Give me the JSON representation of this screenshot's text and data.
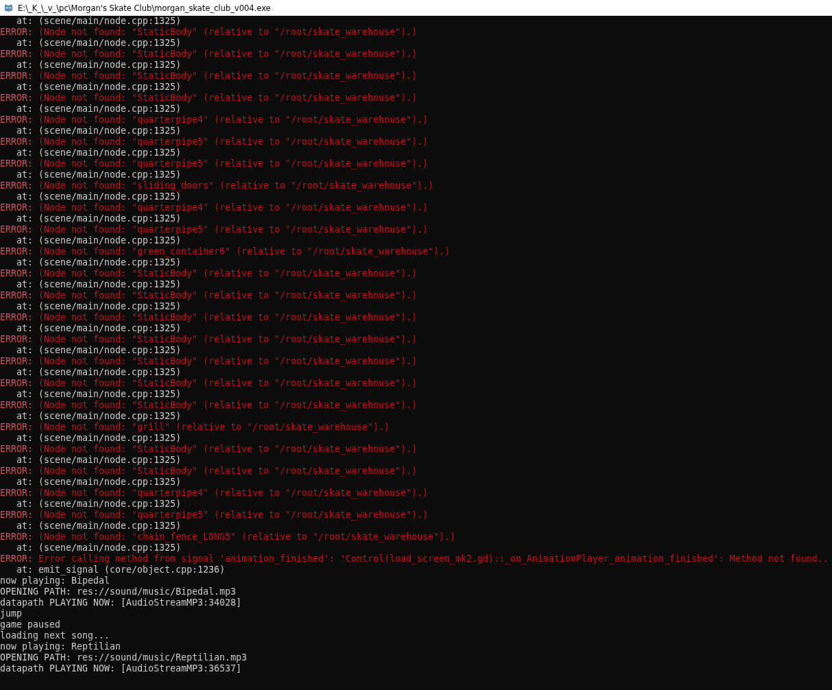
{
  "window": {
    "title": "E:\\_K_\\_v_\\pc\\Morgan's Skate Club\\morgan_skate_club_v004.exe"
  },
  "lines": [
    {
      "kind": "trace",
      "text": "at: (scene/main/node.cpp:1325)"
    },
    {
      "kind": "error",
      "label": "ERROR:",
      "text": "(Node not found: \"StaticBody\" (relative to \"/root/skate_warehouse\").)"
    },
    {
      "kind": "trace",
      "text": "at: (scene/main/node.cpp:1325)"
    },
    {
      "kind": "error",
      "label": "ERROR:",
      "text": "(Node not found: \"StaticBody\" (relative to \"/root/skate_warehouse\").)"
    },
    {
      "kind": "trace",
      "text": "at: (scene/main/node.cpp:1325)"
    },
    {
      "kind": "error",
      "label": "ERROR:",
      "text": "(Node not found: \"StaticBody\" (relative to \"/root/skate_warehouse\").)"
    },
    {
      "kind": "trace",
      "text": "at: (scene/main/node.cpp:1325)"
    },
    {
      "kind": "error",
      "label": "ERROR:",
      "text": "(Node not found: \"StaticBody\" (relative to \"/root/skate_warehouse\").)"
    },
    {
      "kind": "trace",
      "text": "at: (scene/main/node.cpp:1325)"
    },
    {
      "kind": "error",
      "label": "ERROR:",
      "text": "(Node not found: \"quarterpipe4\" (relative to \"/root/skate_warehouse\").)"
    },
    {
      "kind": "trace",
      "text": "at: (scene/main/node.cpp:1325)"
    },
    {
      "kind": "error",
      "label": "ERROR:",
      "text": "(Node not found: \"quarterpipe5\" (relative to \"/root/skate_warehouse\").)"
    },
    {
      "kind": "trace",
      "text": "at: (scene/main/node.cpp:1325)"
    },
    {
      "kind": "error",
      "label": "ERROR:",
      "text": "(Node not found: \"quarterpipe5\" (relative to \"/root/skate_warehouse\").)"
    },
    {
      "kind": "trace",
      "text": "at: (scene/main/node.cpp:1325)"
    },
    {
      "kind": "error",
      "label": "ERROR:",
      "text": "(Node not found: \"sliding_doors\" (relative to \"/root/skate_warehouse\").)"
    },
    {
      "kind": "trace",
      "text": "at: (scene/main/node.cpp:1325)"
    },
    {
      "kind": "error",
      "label": "ERROR:",
      "text": "(Node not found: \"quarterpipe4\" (relative to \"/root/skate_warehouse\").)"
    },
    {
      "kind": "trace",
      "text": "at: (scene/main/node.cpp:1325)"
    },
    {
      "kind": "error",
      "label": "ERROR:",
      "text": "(Node not found: \"quarterpipe5\" (relative to \"/root/skate_warehouse\").)"
    },
    {
      "kind": "trace",
      "text": "at: (scene/main/node.cpp:1325)"
    },
    {
      "kind": "error",
      "label": "ERROR:",
      "text": "(Node not found: \"green_container6\" (relative to \"/root/skate_warehouse\").)"
    },
    {
      "kind": "trace",
      "text": "at: (scene/main/node.cpp:1325)"
    },
    {
      "kind": "error",
      "label": "ERROR:",
      "text": "(Node not found: \"StaticBody\" (relative to \"/root/skate_warehouse\").)"
    },
    {
      "kind": "trace",
      "text": "at: (scene/main/node.cpp:1325)"
    },
    {
      "kind": "error",
      "label": "ERROR:",
      "text": "(Node not found: \"StaticBody\" (relative to \"/root/skate_warehouse\").)"
    },
    {
      "kind": "trace",
      "text": "at: (scene/main/node.cpp:1325)"
    },
    {
      "kind": "error",
      "label": "ERROR:",
      "text": "(Node not found: \"StaticBody\" (relative to \"/root/skate_warehouse\").)"
    },
    {
      "kind": "trace",
      "text": "at: (scene/main/node.cpp:1325)"
    },
    {
      "kind": "error",
      "label": "ERROR:",
      "text": "(Node not found: \"StaticBody\" (relative to \"/root/skate_warehouse\").)"
    },
    {
      "kind": "trace",
      "text": "at: (scene/main/node.cpp:1325)"
    },
    {
      "kind": "error",
      "label": "ERROR:",
      "text": "(Node not found: \"StaticBody\" (relative to \"/root/skate_warehouse\").)"
    },
    {
      "kind": "trace",
      "text": "at: (scene/main/node.cpp:1325)"
    },
    {
      "kind": "error",
      "label": "ERROR:",
      "text": "(Node not found: \"StaticBody\" (relative to \"/root/skate_warehouse\").)"
    },
    {
      "kind": "trace",
      "text": "at: (scene/main/node.cpp:1325)"
    },
    {
      "kind": "error",
      "label": "ERROR:",
      "text": "(Node not found: \"StaticBody\" (relative to \"/root/skate_warehouse\").)"
    },
    {
      "kind": "trace",
      "text": "at: (scene/main/node.cpp:1325)"
    },
    {
      "kind": "error",
      "label": "ERROR:",
      "text": "(Node not found: \"grill\" (relative to \"/root/skate_warehouse\").)"
    },
    {
      "kind": "trace",
      "text": "at: (scene/main/node.cpp:1325)"
    },
    {
      "kind": "error",
      "label": "ERROR:",
      "text": "(Node not found: \"StaticBody\" (relative to \"/root/skate_warehouse\").)"
    },
    {
      "kind": "trace",
      "text": "at: (scene/main/node.cpp:1325)"
    },
    {
      "kind": "error",
      "label": "ERROR:",
      "text": "(Node not found: \"StaticBody\" (relative to \"/root/skate_warehouse\").)"
    },
    {
      "kind": "trace",
      "text": "at: (scene/main/node.cpp:1325)"
    },
    {
      "kind": "error",
      "label": "ERROR:",
      "text": "(Node not found: \"quarterpipe4\" (relative to \"/root/skate_warehouse\").)"
    },
    {
      "kind": "trace",
      "text": "at: (scene/main/node.cpp:1325)"
    },
    {
      "kind": "error",
      "label": "ERROR:",
      "text": "(Node not found: \"quarterpipe5\" (relative to \"/root/skate_warehouse\").)"
    },
    {
      "kind": "trace",
      "text": "at: (scene/main/node.cpp:1325)"
    },
    {
      "kind": "error",
      "label": "ERROR:",
      "text": "(Node not found: \"chain_fence_LONG5\" (relative to \"/root/skate_warehouse\").)"
    },
    {
      "kind": "trace",
      "text": "at: (scene/main/node.cpp:1325)"
    },
    {
      "kind": "error",
      "label": "ERROR:",
      "text": "Error calling method from signal 'animation_finished': 'Control(load_screen_mk2.gd)::_on_AnimationPlayer_animation_finished': Method not found.."
    },
    {
      "kind": "trace",
      "text": "at: emit_signal (core/object.cpp:1236)"
    },
    {
      "kind": "log",
      "text": "now playing: Bipedal"
    },
    {
      "kind": "log",
      "text": "OPENING PATH: res://sound/music/Bipedal.mp3"
    },
    {
      "kind": "log",
      "text": "datapath PLAYING NOW: [AudioStreamMP3:34028]"
    },
    {
      "kind": "log",
      "text": "jump"
    },
    {
      "kind": "log",
      "text": "game paused"
    },
    {
      "kind": "log",
      "text": "loading next song..."
    },
    {
      "kind": "log",
      "text": "now playing: Reptilian"
    },
    {
      "kind": "log",
      "text": "OPENING PATH: res://sound/music/Reptilian.mp3"
    },
    {
      "kind": "log",
      "text": "datapath PLAYING NOW: [AudioStreamMP3:36537]"
    }
  ]
}
